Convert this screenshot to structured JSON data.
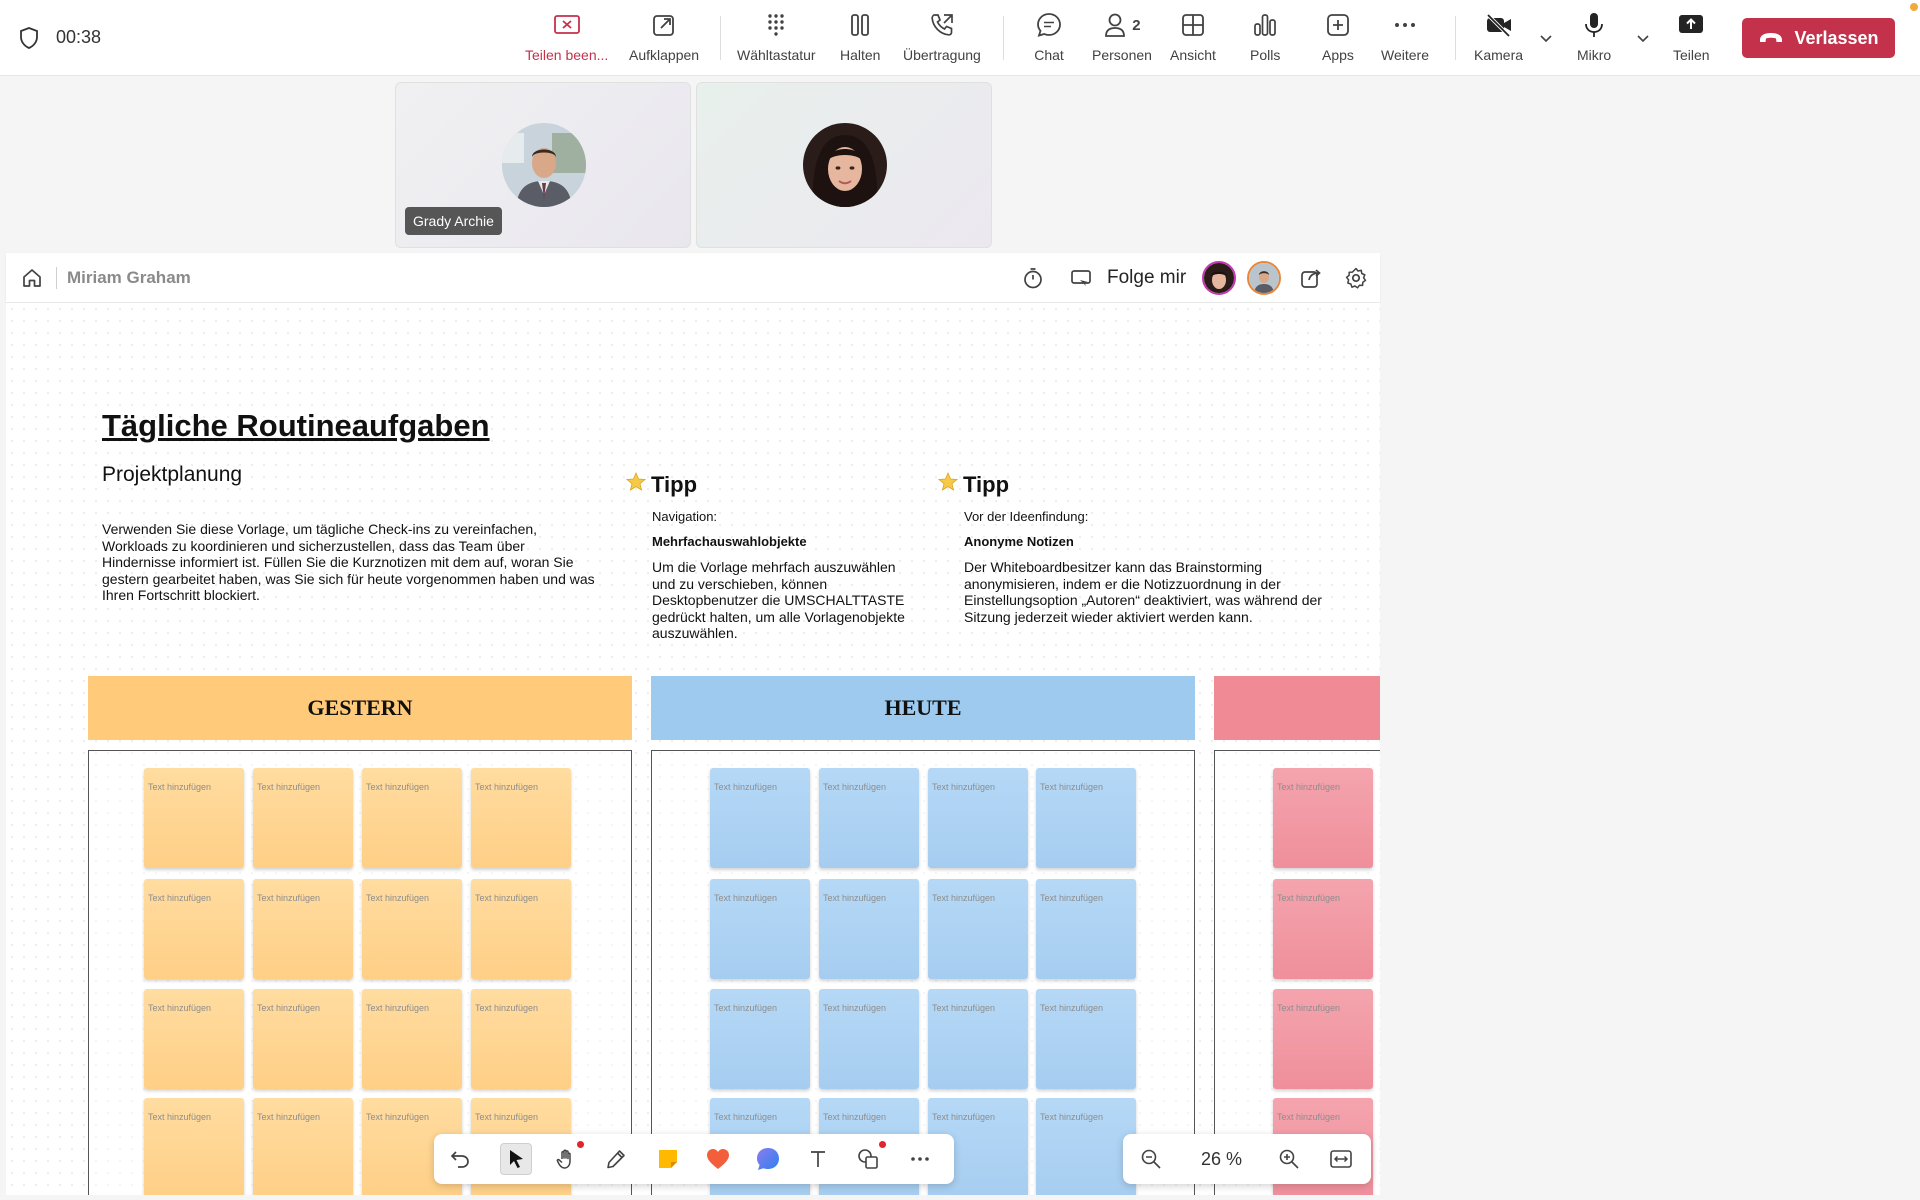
{
  "call": {
    "timer": "00:38",
    "toolbar": [
      {
        "id": "stop-share",
        "label": "Teilen been...",
        "icon": "stop-share-icon"
      },
      {
        "id": "popout",
        "label": "Aufklappen",
        "icon": "popout-icon"
      },
      {
        "id": "dialpad",
        "label": "Wähltastatur",
        "icon": "dialpad-icon"
      },
      {
        "id": "hold",
        "label": "Halten",
        "icon": "pause-icon"
      },
      {
        "id": "transfer",
        "label": "Übertragung",
        "icon": "phone-transfer-icon"
      },
      {
        "id": "chat",
        "label": "Chat",
        "icon": "chat-icon"
      },
      {
        "id": "people",
        "label": "Personen",
        "icon": "people-icon",
        "count": "2"
      },
      {
        "id": "view",
        "label": "Ansicht",
        "icon": "grid-icon"
      },
      {
        "id": "polls",
        "label": "Polls",
        "icon": "polls-icon"
      },
      {
        "id": "apps",
        "label": "Apps",
        "icon": "add-app-icon"
      },
      {
        "id": "more",
        "label": "Weitere",
        "icon": "more-icon"
      },
      {
        "id": "camera",
        "label": "Kamera",
        "icon": "camera-off-icon"
      },
      {
        "id": "mic",
        "label": "Mikro",
        "icon": "mic-icon"
      },
      {
        "id": "share",
        "label": "Teilen",
        "icon": "share-screen-icon"
      }
    ],
    "leave_label": "Verlassen",
    "colors": {
      "leave": "#c4314b",
      "accent": "#6264a7"
    }
  },
  "participants": [
    {
      "name": "Grady Archie",
      "show_label": true
    },
    {
      "name": "",
      "show_label": false
    }
  ],
  "whiteboard": {
    "owner": "Miriam Graham",
    "follow_label": "Folge mir",
    "title": "Tägliche Routineaufgaben",
    "subtitle": "Projektplanung",
    "intro": "Verwenden Sie diese Vorlage, um tägliche Check-ins zu vereinfachen, Workloads zu koordinieren und sicherzustellen, dass das Team über Hindernisse informiert ist. Füllen Sie die Kurznotizen mit dem auf, woran Sie gestern gearbeitet haben, was Sie sich für heute vorgenommen haben und was Ihren Fortschritt blockiert.",
    "tips": [
      {
        "heading": "Tipp",
        "small": "Navigation:",
        "bold": "Mehrfachauswahlobjekte",
        "body": "Um die Vorlage mehrfach auszuwählen und zu verschieben, können Desktopbenutzer die UMSCHALTTASTE gedrückt halten, um alle Vorlagenobjekte auszuwählen."
      },
      {
        "heading": "Tipp",
        "small": "Vor der Ideenfindung:",
        "bold": "Anonyme Notizen",
        "body": "Der Whiteboardbesitzer kann das Brainstorming anonymisieren, indem er die Notizzuordnung in der Einstellungsoption „Autoren“ deaktiviert, was während der Sitzung jederzeit wieder aktiviert werden kann."
      }
    ],
    "columns": [
      {
        "title": "GESTERN",
        "color": "#ffca7a"
      },
      {
        "title": "HEUTE",
        "color": "#9dcaee"
      },
      {
        "title": "",
        "color": "#f08a94"
      }
    ],
    "note_placeholder": "Text hinzufügen",
    "zoom": "26 %",
    "tools": [
      "undo-icon",
      "select-icon",
      "hand-icon",
      "pen-icon",
      "sticky-note-icon",
      "reaction-heart-icon",
      "comment-icon",
      "text-icon",
      "shapes-icon",
      "more-icon"
    ]
  }
}
